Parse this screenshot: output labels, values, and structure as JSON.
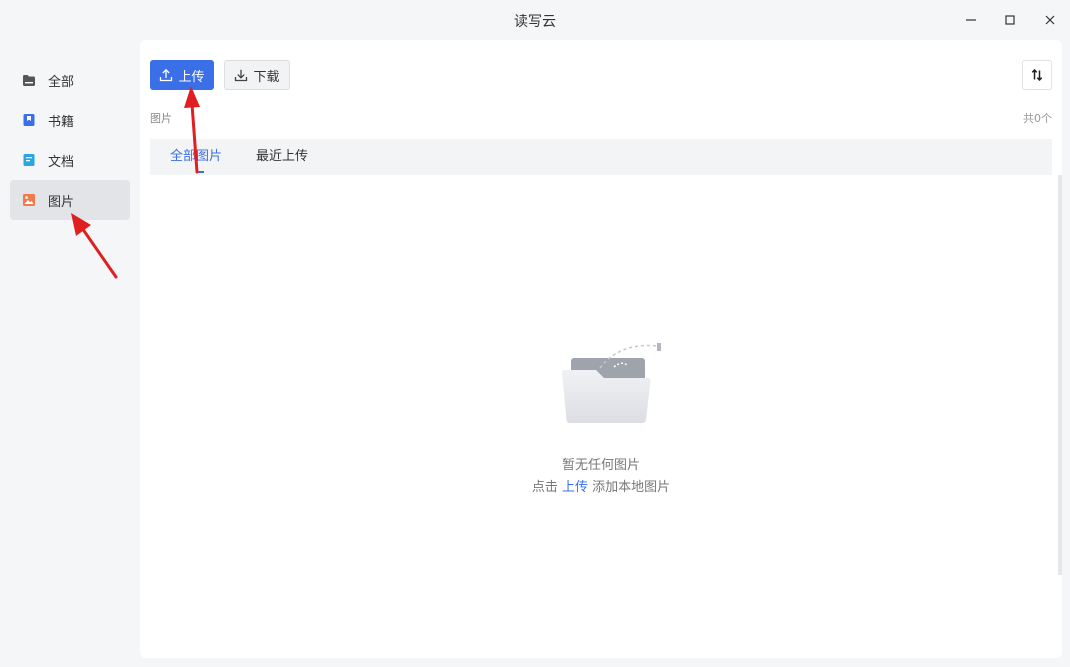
{
  "window": {
    "title": "读写云",
    "icons": {
      "minimize": "minimize-icon",
      "maximize": "maximize-icon",
      "close": "close-icon"
    }
  },
  "sidebar": {
    "items": [
      {
        "label": "全部",
        "icon": "folder-icon",
        "color": "#555555",
        "active": false
      },
      {
        "label": "书籍",
        "icon": "book-icon",
        "color": "#3a6fe8",
        "active": false
      },
      {
        "label": "文档",
        "icon": "document-icon",
        "color": "#2aa7e0",
        "active": false
      },
      {
        "label": "图片",
        "icon": "image-icon",
        "color": "#f07a4a",
        "active": true
      }
    ]
  },
  "toolbar": {
    "upload_label": "上传",
    "download_label": "下载",
    "upload_color": "#3a6fe8",
    "sort_icon": "sort-icon"
  },
  "breadcrumb": "图片",
  "count_text": "共0个",
  "tabs": [
    {
      "label": "全部图片",
      "active": true
    },
    {
      "label": "最近上传",
      "active": false
    }
  ],
  "empty_state": {
    "line1": "暂无任何图片",
    "line2_prefix": "点击",
    "line2_link": "上传",
    "line2_suffix": "添加本地图片",
    "illustration": "empty-folder-icon"
  },
  "annotations": {
    "arrow_color": "#e02020"
  }
}
